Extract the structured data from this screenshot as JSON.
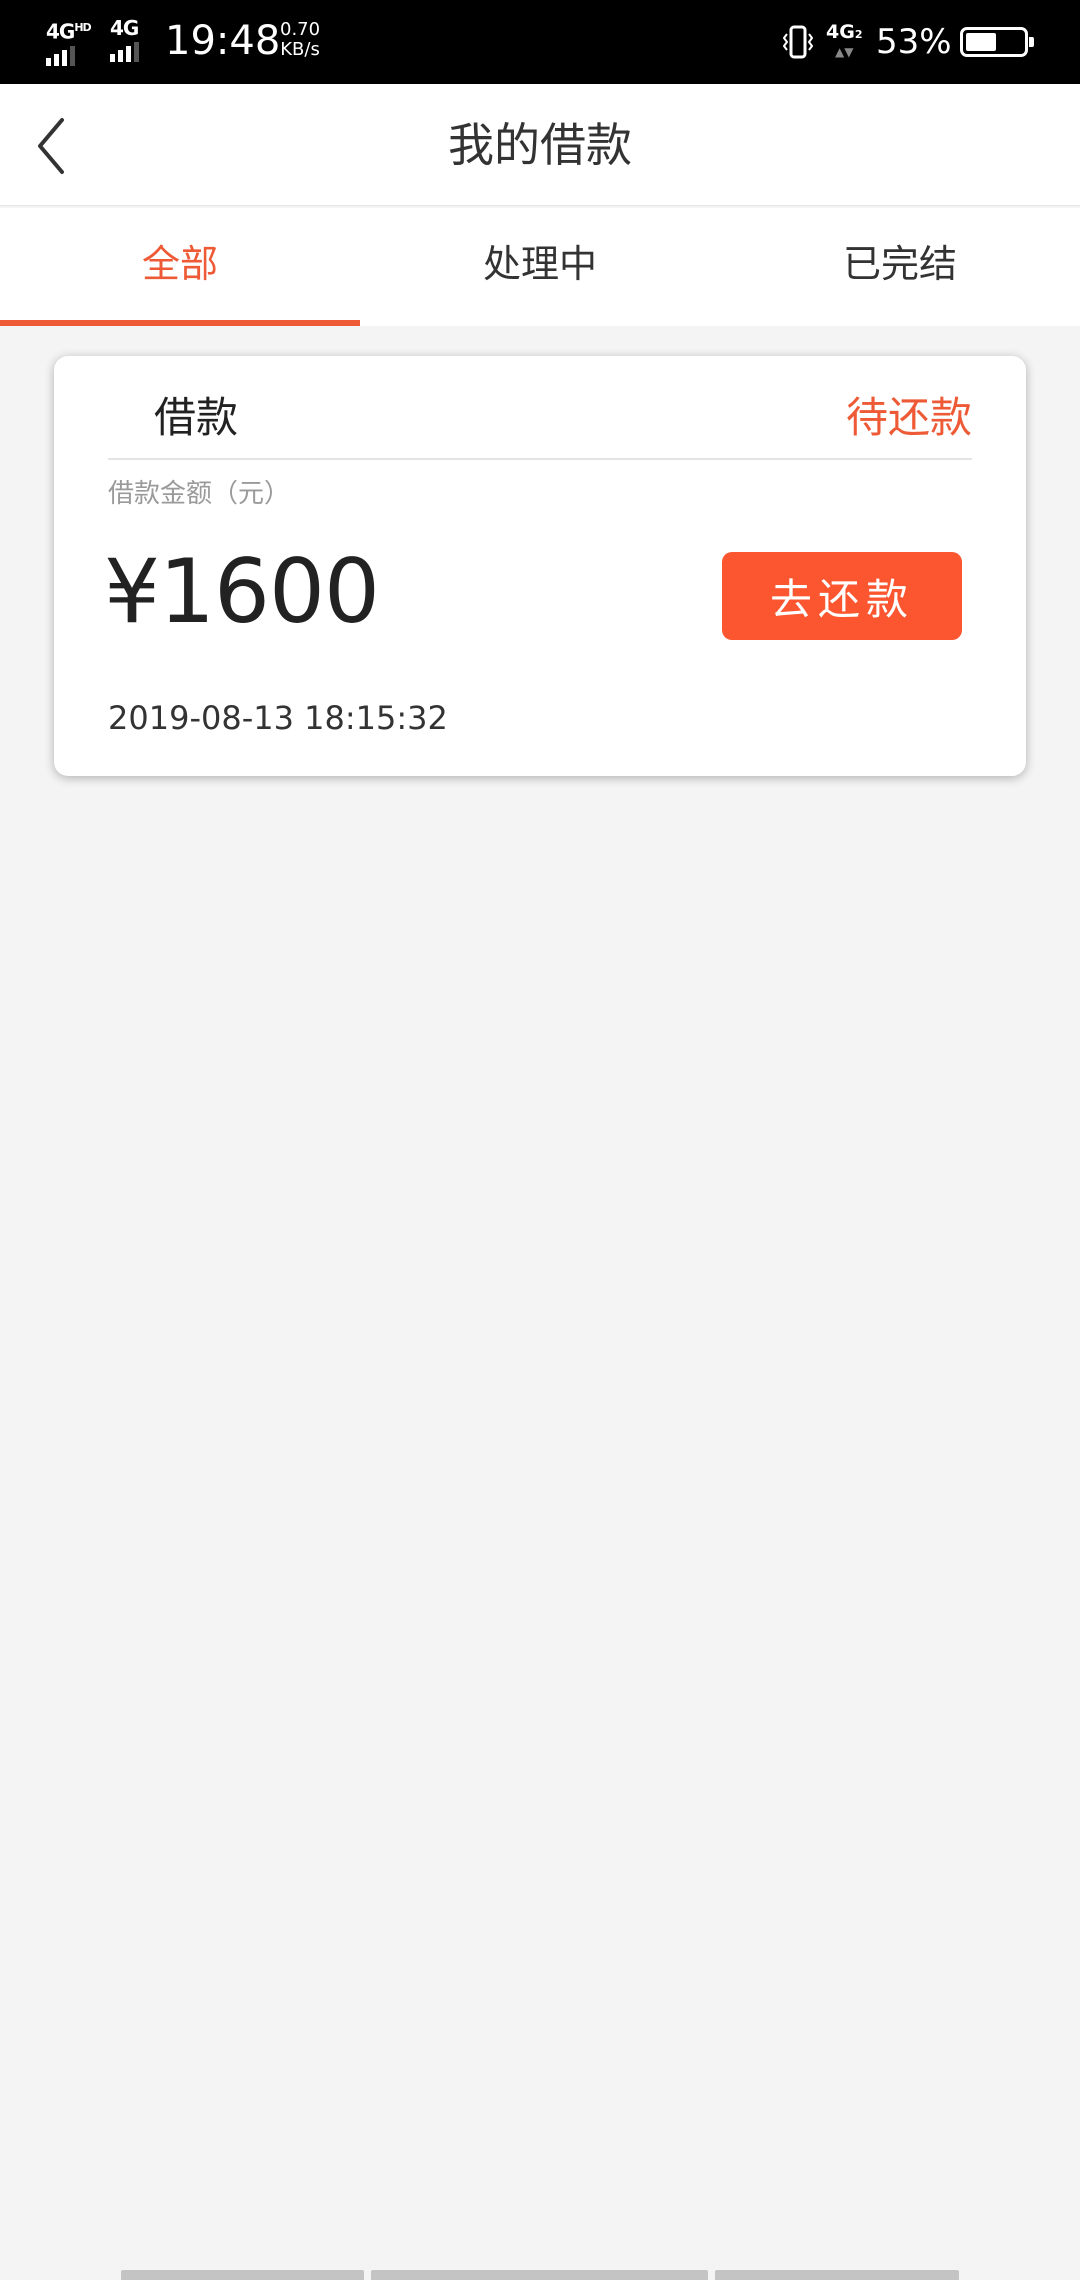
{
  "status_bar": {
    "sim1": "4G",
    "sim1_sup": "HD",
    "sim2": "4G",
    "time": "19:48",
    "speed_value": "0.70",
    "speed_unit": "KB/s",
    "sim2_label": "4G",
    "sim2_sub": "2",
    "battery_pct": "53%",
    "battery_level": 0.53
  },
  "nav": {
    "title": "我的借款",
    "back_icon": "chevron-left-icon"
  },
  "tabs": [
    {
      "label": "全部",
      "active": true
    },
    {
      "label": "处理中",
      "active": false
    },
    {
      "label": "已完结",
      "active": false
    }
  ],
  "loan_card": {
    "type": "借款",
    "status": "待还款",
    "amount_label": "借款金额（元）",
    "amount": "¥1600",
    "repay_button": "去还款",
    "date": "2019-08-13 18:15:32"
  },
  "colors": {
    "accent": "#ee5a35",
    "button": "#fc5630",
    "background": "#f4f4f4"
  }
}
